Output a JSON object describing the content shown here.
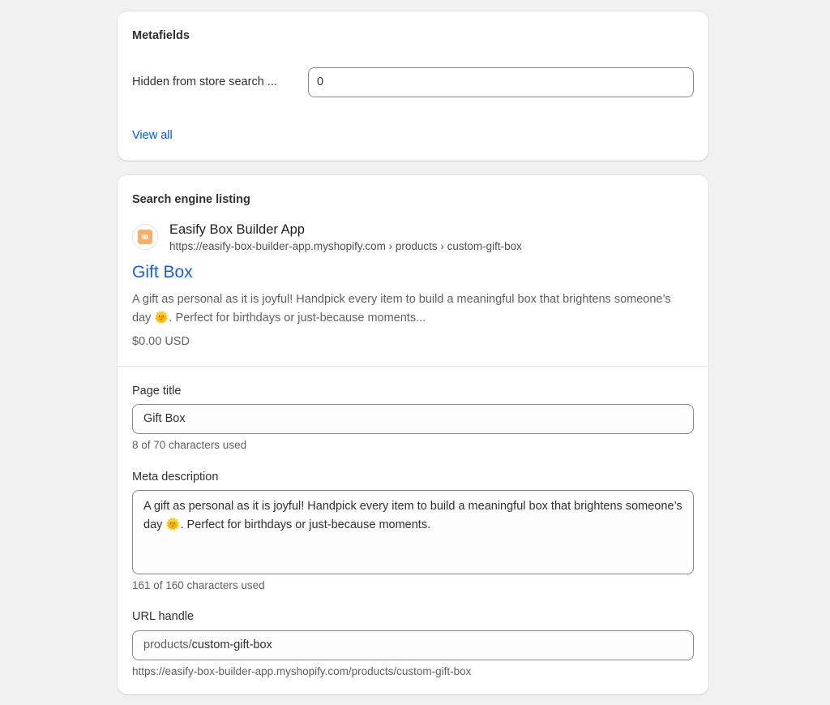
{
  "metafields": {
    "title": "Metafields",
    "field_label": "Hidden from store search ...",
    "field_value": "0",
    "view_all": "View all"
  },
  "seo": {
    "title": "Search engine listing",
    "preview": {
      "site_name": "Easify Box Builder App",
      "url": "https://easify-box-builder-app.myshopify.com › products › custom-gift-box",
      "title": "Gift Box",
      "description": "A gift as personal as it is joyful! Handpick every item to build a meaningful box that brightens someone’s day 🌞. Perfect for birthdays or just-because moments...",
      "price": "$0.00 USD"
    },
    "page_title": {
      "label": "Page title",
      "value": "Gift Box",
      "help": "8 of 70 characters used"
    },
    "meta_description": {
      "label": "Meta description",
      "value": "A gift as personal as it is joyful! Handpick every item to build a meaningful box that brightens someone’s day 🌞. Perfect for birthdays or just-because moments.",
      "help": "161 of 160 characters used"
    },
    "url_handle": {
      "label": "URL handle",
      "prefix": "products/",
      "value": "custom-gift-box",
      "help": "https://easify-box-builder-app.myshopify.com/products/custom-gift-box"
    }
  },
  "icons": {
    "favicon": "store-favicon-icon"
  }
}
